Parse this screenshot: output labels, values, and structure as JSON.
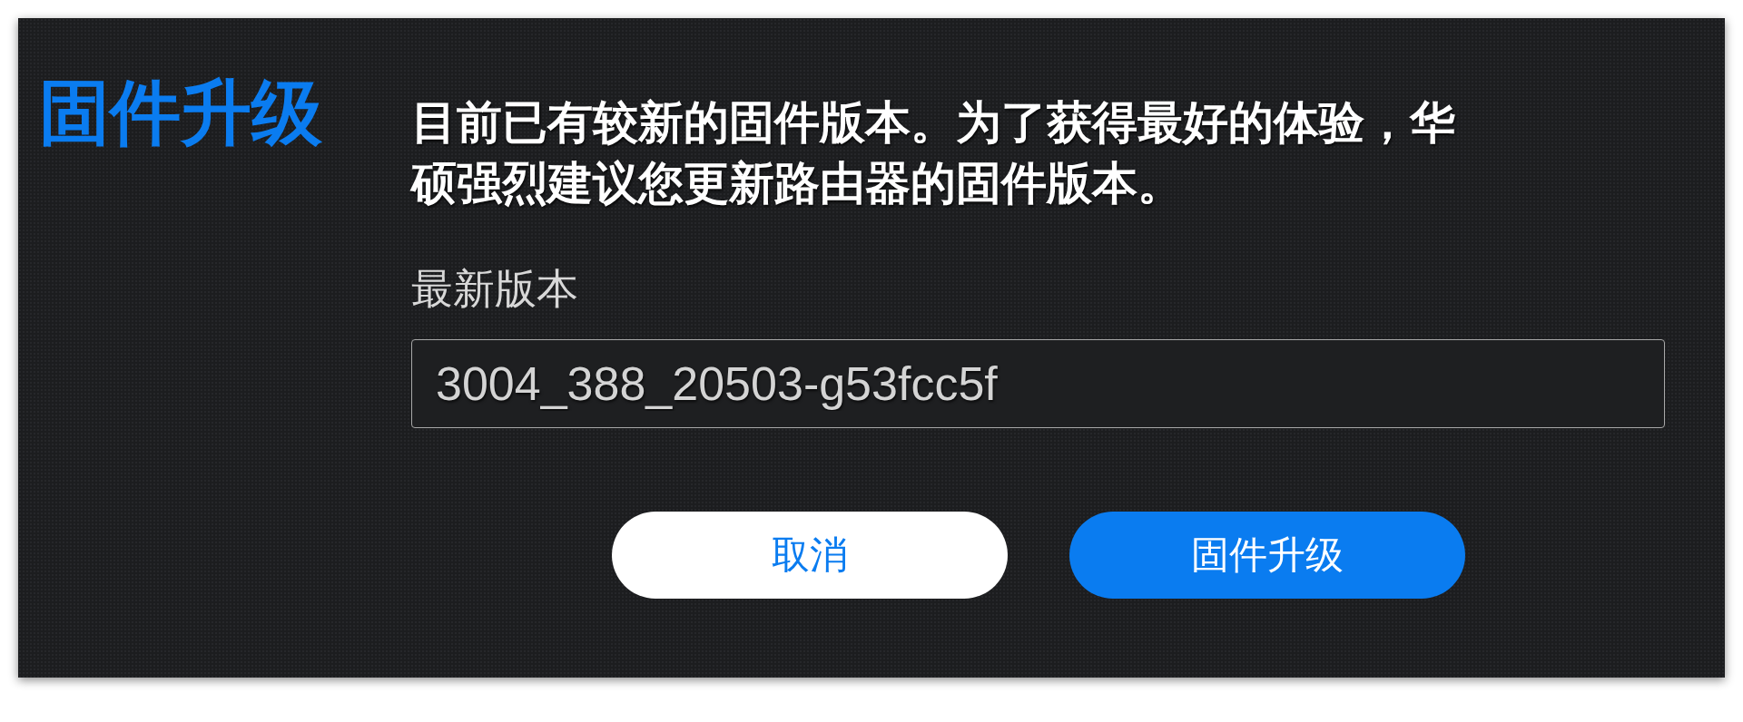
{
  "title": "固件升级",
  "message": "目前已有较新的固件版本。为了获得最好的体验，华硕强烈建议您更新路由器的固件版本。",
  "latest_version": {
    "label": "最新版本",
    "value": "3004_388_20503-g53fcc5f"
  },
  "buttons": [
    {
      "label": "取消",
      "kind": "secondary"
    },
    {
      "label": "固件升级",
      "kind": "primary"
    }
  ]
}
